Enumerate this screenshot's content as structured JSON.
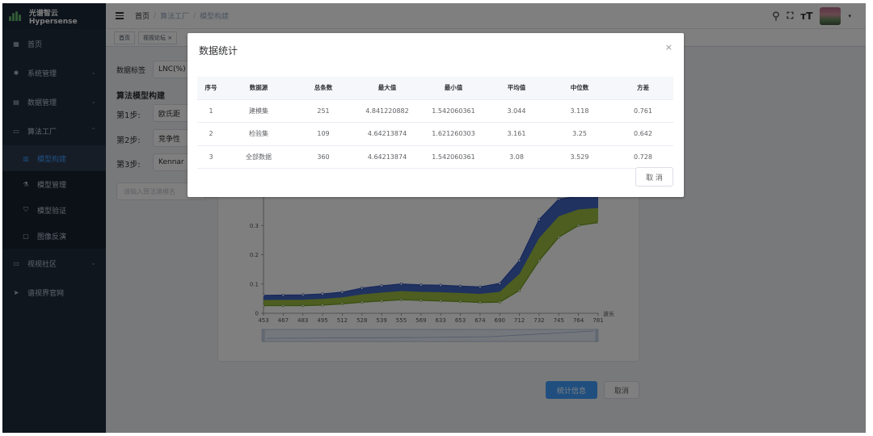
{
  "app": {
    "logo_text": "光谱智云Hypersense"
  },
  "sidebar": {
    "items": [
      {
        "label": "首页",
        "icon": "dashboard-icon"
      },
      {
        "label": "系统管理",
        "icon": "gear-icon"
      },
      {
        "label": "数据管理",
        "icon": "database-icon"
      },
      {
        "label": "算法工厂",
        "icon": "monitor-icon"
      },
      {
        "label": "视视社区",
        "icon": "community-icon"
      },
      {
        "label": "谱视界官网",
        "icon": "send-icon"
      }
    ],
    "submenu": [
      {
        "label": "模型构建",
        "icon": "grid-icon",
        "active": true
      },
      {
        "label": "模型管理",
        "icon": "flask-icon",
        "active": false
      },
      {
        "label": "模型验证",
        "icon": "shield-icon",
        "active": false
      },
      {
        "label": "图像反演",
        "icon": "image-icon",
        "active": false
      }
    ]
  },
  "header": {
    "breadcrumb": [
      "首页",
      "算法工厂",
      "模型构建"
    ]
  },
  "tags": [
    "首页",
    "视视论坛 ×"
  ],
  "form": {
    "data_label_label": "数据标签",
    "data_label_value": "LNC(%)",
    "section_title": "算法模型构建",
    "steps": [
      {
        "label": "第1步:",
        "value": "欧氏距"
      },
      {
        "label": "第2步:",
        "value": "竞争性"
      },
      {
        "label": "第3步:",
        "value": "Kennar"
      }
    ],
    "algo_name_placeholder": "请输入算法建模名"
  },
  "chart_data": {
    "type": "line",
    "x": [
      453,
      467,
      483,
      495,
      512,
      528,
      539,
      555,
      569,
      633,
      653,
      674,
      690,
      712,
      732,
      745,
      764,
      781
    ],
    "xlabel": "波长",
    "ylabel": "",
    "yticks": [
      0,
      0.1,
      0.2,
      0.3
    ],
    "ylim": [
      0,
      0.4
    ],
    "series": [
      {
        "band": "blue-upper",
        "color": "#3b5fc7",
        "values": [
          0.061,
          0.062,
          0.063,
          0.066,
          0.072,
          0.086,
          0.094,
          0.1,
          0.097,
          0.096,
          0.093,
          0.09,
          0.102,
          0.18,
          0.32,
          0.39,
          0.4,
          0.4
        ]
      },
      {
        "band": "green-lower",
        "color": "#8fb52b",
        "values": [
          0.026,
          0.026,
          0.026,
          0.028,
          0.032,
          0.038,
          0.042,
          0.046,
          0.044,
          0.042,
          0.04,
          0.037,
          0.038,
          0.078,
          0.18,
          0.26,
          0.3,
          0.31
        ]
      }
    ]
  },
  "buttons": {
    "stats_label": "统计信息",
    "cancel_label": "取消"
  },
  "dialog": {
    "title": "数据统计",
    "close": "×",
    "columns": [
      "序号",
      "数据源",
      "总条数",
      "最大值",
      "最小值",
      "平均值",
      "中位数",
      "方差"
    ],
    "rows": [
      [
        "1",
        "建模集",
        "251",
        "4.841220882",
        "1.542060361",
        "3.044",
        "3.118",
        "0.761"
      ],
      [
        "2",
        "检验集",
        "109",
        "4.64213874",
        "1.621260303",
        "3.161",
        "3.25",
        "0.642"
      ],
      [
        "3",
        "全部数据",
        "360",
        "4.64213874",
        "1.542060361",
        "3.08",
        "3.529",
        "0.728"
      ]
    ],
    "cancel_label": "取 消"
  },
  "colors": {
    "sidebar_bg": "#1f2d3d",
    "accent": "#409eff",
    "line_blue": "#3b5fc7",
    "line_green": "#8fb52b"
  }
}
